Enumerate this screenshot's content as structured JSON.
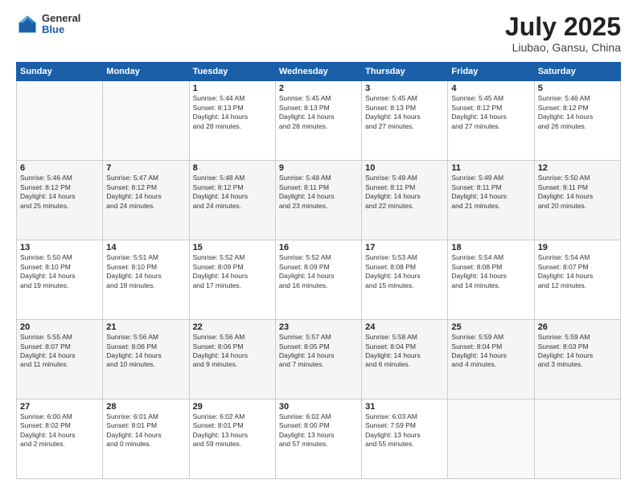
{
  "header": {
    "logo": {
      "general": "General",
      "blue": "Blue"
    },
    "title": "July 2025",
    "location": "Liubao, Gansu, China"
  },
  "weekdays": [
    "Sunday",
    "Monday",
    "Tuesday",
    "Wednesday",
    "Thursday",
    "Friday",
    "Saturday"
  ],
  "weeks": [
    [
      {
        "day": "",
        "info": ""
      },
      {
        "day": "",
        "info": ""
      },
      {
        "day": "1",
        "info": "Sunrise: 5:44 AM\nSunset: 8:13 PM\nDaylight: 14 hours\nand 28 minutes."
      },
      {
        "day": "2",
        "info": "Sunrise: 5:45 AM\nSunset: 8:13 PM\nDaylight: 14 hours\nand 28 minutes."
      },
      {
        "day": "3",
        "info": "Sunrise: 5:45 AM\nSunset: 8:13 PM\nDaylight: 14 hours\nand 27 minutes."
      },
      {
        "day": "4",
        "info": "Sunrise: 5:45 AM\nSunset: 8:12 PM\nDaylight: 14 hours\nand 27 minutes."
      },
      {
        "day": "5",
        "info": "Sunrise: 5:46 AM\nSunset: 8:12 PM\nDaylight: 14 hours\nand 26 minutes."
      }
    ],
    [
      {
        "day": "6",
        "info": "Sunrise: 5:46 AM\nSunset: 8:12 PM\nDaylight: 14 hours\nand 25 minutes."
      },
      {
        "day": "7",
        "info": "Sunrise: 5:47 AM\nSunset: 8:12 PM\nDaylight: 14 hours\nand 24 minutes."
      },
      {
        "day": "8",
        "info": "Sunrise: 5:48 AM\nSunset: 8:12 PM\nDaylight: 14 hours\nand 24 minutes."
      },
      {
        "day": "9",
        "info": "Sunrise: 5:48 AM\nSunset: 8:11 PM\nDaylight: 14 hours\nand 23 minutes."
      },
      {
        "day": "10",
        "info": "Sunrise: 5:49 AM\nSunset: 8:11 PM\nDaylight: 14 hours\nand 22 minutes."
      },
      {
        "day": "11",
        "info": "Sunrise: 5:49 AM\nSunset: 8:11 PM\nDaylight: 14 hours\nand 21 minutes."
      },
      {
        "day": "12",
        "info": "Sunrise: 5:50 AM\nSunset: 8:11 PM\nDaylight: 14 hours\nand 20 minutes."
      }
    ],
    [
      {
        "day": "13",
        "info": "Sunrise: 5:50 AM\nSunset: 8:10 PM\nDaylight: 14 hours\nand 19 minutes."
      },
      {
        "day": "14",
        "info": "Sunrise: 5:51 AM\nSunset: 8:10 PM\nDaylight: 14 hours\nand 18 minutes."
      },
      {
        "day": "15",
        "info": "Sunrise: 5:52 AM\nSunset: 8:09 PM\nDaylight: 14 hours\nand 17 minutes."
      },
      {
        "day": "16",
        "info": "Sunrise: 5:52 AM\nSunset: 8:09 PM\nDaylight: 14 hours\nand 16 minutes."
      },
      {
        "day": "17",
        "info": "Sunrise: 5:53 AM\nSunset: 8:08 PM\nDaylight: 14 hours\nand 15 minutes."
      },
      {
        "day": "18",
        "info": "Sunrise: 5:54 AM\nSunset: 8:08 PM\nDaylight: 14 hours\nand 14 minutes."
      },
      {
        "day": "19",
        "info": "Sunrise: 5:54 AM\nSunset: 8:07 PM\nDaylight: 14 hours\nand 12 minutes."
      }
    ],
    [
      {
        "day": "20",
        "info": "Sunrise: 5:55 AM\nSunset: 8:07 PM\nDaylight: 14 hours\nand 11 minutes."
      },
      {
        "day": "21",
        "info": "Sunrise: 5:56 AM\nSunset: 8:06 PM\nDaylight: 14 hours\nand 10 minutes."
      },
      {
        "day": "22",
        "info": "Sunrise: 5:56 AM\nSunset: 8:06 PM\nDaylight: 14 hours\nand 9 minutes."
      },
      {
        "day": "23",
        "info": "Sunrise: 5:57 AM\nSunset: 8:05 PM\nDaylight: 14 hours\nand 7 minutes."
      },
      {
        "day": "24",
        "info": "Sunrise: 5:58 AM\nSunset: 8:04 PM\nDaylight: 14 hours\nand 6 minutes."
      },
      {
        "day": "25",
        "info": "Sunrise: 5:59 AM\nSunset: 8:04 PM\nDaylight: 14 hours\nand 4 minutes."
      },
      {
        "day": "26",
        "info": "Sunrise: 5:59 AM\nSunset: 8:03 PM\nDaylight: 14 hours\nand 3 minutes."
      }
    ],
    [
      {
        "day": "27",
        "info": "Sunrise: 6:00 AM\nSunset: 8:02 PM\nDaylight: 14 hours\nand 2 minutes."
      },
      {
        "day": "28",
        "info": "Sunrise: 6:01 AM\nSunset: 8:01 PM\nDaylight: 14 hours\nand 0 minutes."
      },
      {
        "day": "29",
        "info": "Sunrise: 6:02 AM\nSunset: 8:01 PM\nDaylight: 13 hours\nand 59 minutes."
      },
      {
        "day": "30",
        "info": "Sunrise: 6:02 AM\nSunset: 8:00 PM\nDaylight: 13 hours\nand 57 minutes."
      },
      {
        "day": "31",
        "info": "Sunrise: 6:03 AM\nSunset: 7:59 PM\nDaylight: 13 hours\nand 55 minutes."
      },
      {
        "day": "",
        "info": ""
      },
      {
        "day": "",
        "info": ""
      }
    ]
  ]
}
